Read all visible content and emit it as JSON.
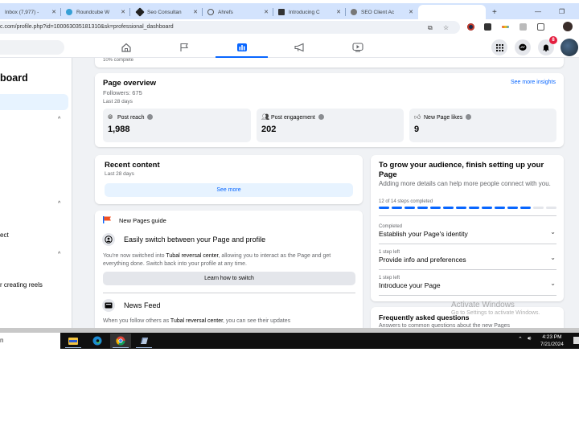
{
  "browser": {
    "tabs": [
      {
        "title": "Inbox (7,977) -",
        "favicon_color": "#d3e3fd"
      },
      {
        "title": "Roundcube W",
        "favicon_color": "#37a0d6"
      },
      {
        "title": "Seo Consultan",
        "favicon_color": "#222222"
      },
      {
        "title": "Ahrefs",
        "favicon_color": "#555555"
      },
      {
        "title": "Introducing C",
        "favicon_color": "#333333"
      },
      {
        "title": "SEO Client Ac",
        "favicon_color": "#777777"
      },
      {
        "title": "",
        "favicon_color": "#ffffff"
      }
    ],
    "close_glyph": "✕",
    "new_tab_glyph": "+",
    "minimize_glyph": "—",
    "restore_glyph": "❐",
    "url": "c.com/profile.php?id=100063035181310&sk=professional_dashboard"
  },
  "fb_header": {
    "nav_tabs": [
      {
        "name": "home",
        "active": false
      },
      {
        "name": "pages",
        "active": false
      },
      {
        "name": "insights",
        "active": true
      },
      {
        "name": "ads",
        "active": false
      },
      {
        "name": "watch",
        "active": false
      }
    ],
    "notification_count": "8",
    "accent": "#0866ff"
  },
  "left_panel": {
    "title": "board",
    "items": [
      "ect",
      "r creating reels"
    ]
  },
  "progress_card": {
    "text": "10% complete"
  },
  "page_overview": {
    "title": "Page overview",
    "followers": "Followers: 675",
    "period": "Last 28 days",
    "see_more": "See more insights",
    "metrics": [
      {
        "label": "Post reach",
        "value": "1,988"
      },
      {
        "label": "Post engagement",
        "value": "202"
      },
      {
        "label": "New Page likes",
        "value": "9"
      }
    ]
  },
  "recent_content": {
    "title": "Recent content",
    "period": "Last 28 days",
    "see_more": "See more"
  },
  "pages_guide": {
    "header": "New Pages guide",
    "sections": [
      {
        "title": "Easily switch between your Page and profile",
        "body_pre": "You're now switched into ",
        "body_bold": "Tubal reversal center",
        "body_post": ", allowing you to interact as the Page and get everything done. Switch back into your profile at any time.",
        "button": "Learn how to switch"
      },
      {
        "title": "News Feed",
        "body_pre": "When you follow others as ",
        "body_bold": "Tubal reversal center",
        "body_post": ", you can see their updates"
      }
    ]
  },
  "setup_card": {
    "title": "To grow your audience, finish setting up your Page",
    "description": "Adding more details can help more people connect with you.",
    "steps_text": "12 of 14 steps completed",
    "steps_completed": 12,
    "steps_total": 14,
    "steps": [
      {
        "status": "Completed",
        "title": "Establish your Page's identity"
      },
      {
        "status": "1 step left",
        "title": "Provide info and preferences"
      },
      {
        "status": "1 step left",
        "title": "Introduce your Page"
      }
    ]
  },
  "faq_card": {
    "title": "Frequently asked questions",
    "subtitle": "Answers to common questions about the new Pages"
  },
  "watermark": {
    "line1": "Activate Windows",
    "line2": "Go to Settings to activate Windows."
  },
  "taskbar": {
    "search_text": "n",
    "time": "4:23 PM",
    "date": "7/21/2024"
  }
}
